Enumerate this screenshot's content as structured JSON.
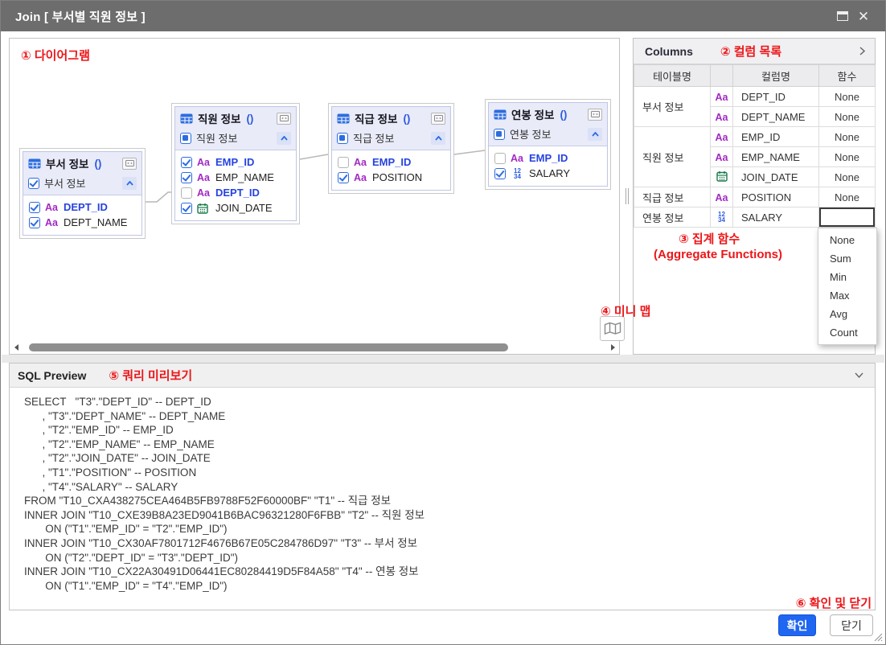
{
  "window": {
    "title": "Join [ 부서별 직원 정보 ]"
  },
  "annotations": {
    "diagram": "① 다이어그램",
    "columns": "② 컬럼 목록",
    "aggregate_line1": "③ 집계 함수",
    "aggregate_line2": "(Aggregate Functions)",
    "minimap": "④ 미니 맵",
    "sql": "⑤ 쿼리 미리보기",
    "confirm": "⑥ 확인 및 닫기"
  },
  "icons": {
    "type_text": "Aa",
    "type_number_top": "12",
    "type_number_bottom": "34"
  },
  "colors": {
    "annotation_red": "#ed1518",
    "checkbox_blue": "#2d6ce0",
    "key_column_blue": "#2543e0",
    "type_purple": "#a229c4",
    "date_green": "#1a7a4c",
    "ok_button_blue": "#1f66f1",
    "titlebar_gray": "#6d6d6d"
  },
  "diagram": {
    "nodes": [
      {
        "title": "부서 정보",
        "suffix": "()",
        "alias": "부서 정보",
        "alias_state": "checked",
        "columns": [
          {
            "name": "DEPT_ID",
            "type": "text",
            "checked": true,
            "key": true
          },
          {
            "name": "DEPT_NAME",
            "type": "text",
            "checked": true,
            "key": false
          }
        ]
      },
      {
        "title": "직원 정보",
        "suffix": "()",
        "alias": "직원 정보",
        "alias_state": "partial",
        "columns": [
          {
            "name": "EMP_ID",
            "type": "text",
            "checked": true,
            "key": true
          },
          {
            "name": "EMP_NAME",
            "type": "text",
            "checked": true,
            "key": false
          },
          {
            "name": "DEPT_ID",
            "type": "text",
            "checked": false,
            "key": true
          },
          {
            "name": "JOIN_DATE",
            "type": "date",
            "checked": true,
            "key": false
          }
        ]
      },
      {
        "title": "직급 정보",
        "suffix": "()",
        "alias": "직급 정보",
        "alias_state": "partial",
        "columns": [
          {
            "name": "EMP_ID",
            "type": "text",
            "checked": false,
            "key": true
          },
          {
            "name": "POSITION",
            "type": "text",
            "checked": true,
            "key": false
          }
        ]
      },
      {
        "title": "연봉 정보",
        "suffix": "()",
        "alias": "연봉 정보",
        "alias_state": "partial",
        "columns": [
          {
            "name": "EMP_ID",
            "type": "text",
            "checked": false,
            "key": true
          },
          {
            "name": "SALARY",
            "type": "number",
            "checked": true,
            "key": false
          }
        ]
      }
    ]
  },
  "columns_panel": {
    "title": "Columns",
    "headers": {
      "table": "테이블명",
      "icon": "",
      "column": "컬럼명",
      "func": "함수"
    },
    "groups": [
      {
        "table": "부서 정보",
        "cols": [
          {
            "type": "text",
            "name": "DEPT_ID",
            "func": "None"
          },
          {
            "type": "text",
            "name": "DEPT_NAME",
            "func": "None"
          }
        ]
      },
      {
        "table": "직원 정보",
        "cols": [
          {
            "type": "text",
            "name": "EMP_ID",
            "func": "None"
          },
          {
            "type": "text",
            "name": "EMP_NAME",
            "func": "None"
          },
          {
            "type": "date",
            "name": "JOIN_DATE",
            "func": "None"
          }
        ]
      },
      {
        "table": "직급 정보",
        "cols": [
          {
            "type": "text",
            "name": "POSITION",
            "func": "None"
          }
        ]
      },
      {
        "table": "연봉 정보",
        "cols": [
          {
            "type": "number",
            "name": "SALARY",
            "func": ""
          }
        ]
      }
    ],
    "dropdown": {
      "options": [
        "None",
        "Sum",
        "Min",
        "Max",
        "Avg",
        "Count"
      ]
    }
  },
  "sql_preview": {
    "title": "SQL Preview",
    "sql": "SELECT   \"T3\".\"DEPT_ID\" -- DEPT_ID\n      , \"T3\".\"DEPT_NAME\" -- DEPT_NAME\n      , \"T2\".\"EMP_ID\" -- EMP_ID\n      , \"T2\".\"EMP_NAME\" -- EMP_NAME\n      , \"T2\".\"JOIN_DATE\" -- JOIN_DATE\n      , \"T1\".\"POSITION\" -- POSITION\n      , \"T4\".\"SALARY\" -- SALARY\nFROM \"T10_CXA438275CEA464B5FB9788F52F60000BF\" \"T1\" -- 직급 정보\nINNER JOIN \"T10_CXE39B8A23ED9041B6BAC96321280F6FBB\" \"T2\" -- 직원 정보\n       ON (\"T1\".\"EMP_ID\" = \"T2\".\"EMP_ID\")\nINNER JOIN \"T10_CX30AF7801712F4676B67E05C284786D97\" \"T3\" -- 부서 정보\n       ON (\"T2\".\"DEPT_ID\" = \"T3\".\"DEPT_ID\")\nINNER JOIN \"T10_CX22A30491D06441EC80284419D5F84A58\" \"T4\" -- 연봉 정보\n       ON (\"T1\".\"EMP_ID\" = \"T4\".\"EMP_ID\")"
  },
  "footer": {
    "ok_label": "확인",
    "close_label": "닫기"
  }
}
